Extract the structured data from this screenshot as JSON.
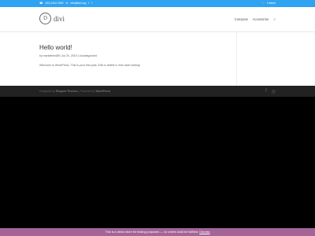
{
  "topbar": {
    "phone": "(00) 4444 0000",
    "email": "info@divi.org",
    "social": [
      "f",
      "t"
    ],
    "cart": "0 Items",
    "bg": "#2ea3f2"
  },
  "header": {
    "logo_mark": "D",
    "logo_text": "divi",
    "nav": [
      "Compras",
      "Accesorios"
    ],
    "search_icon": "search-icon"
  },
  "post": {
    "title": "Hello world!",
    "meta": "by marketmini89  |  Jul 20, 2019  |  Uncategorized",
    "excerpt": "Welcome to WordPress. This is your first post. Edit or delete it, then start writing!"
  },
  "footer": {
    "designed_by": "Designed by",
    "author": "Elegant Themes",
    "powered_by": "Powered by",
    "platform": "WordPress",
    "social": [
      "f",
      "ig"
    ]
  },
  "notice": {
    "text": "This is a demo store for testing purposes — no orders shall be fulfilled.",
    "dismiss": "Dismiss",
    "bg": "#a46497"
  }
}
